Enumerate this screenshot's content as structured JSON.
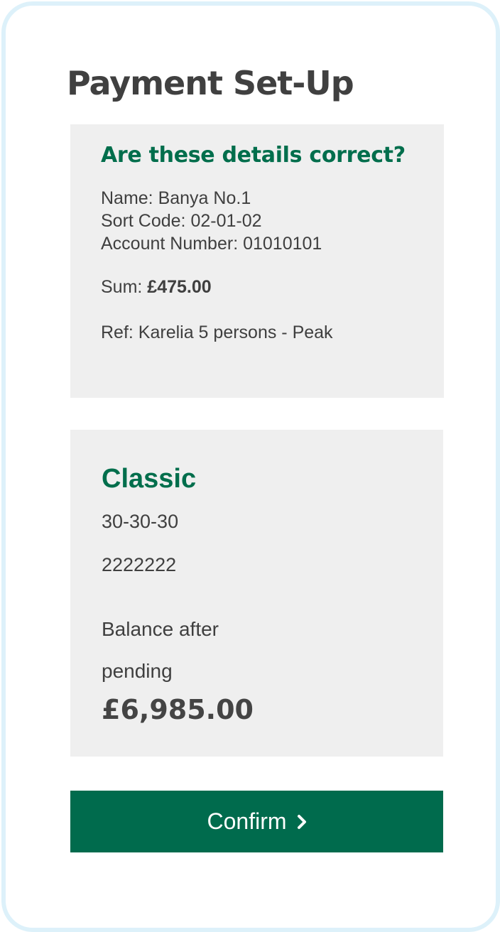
{
  "page": {
    "title": "Payment Set-Up"
  },
  "details": {
    "heading": "Are these details correct?",
    "name_line": "Name: Banya No.1",
    "sort_code_line": "Sort Code: 02-01-02",
    "account_number_line": "Account Number: 01010101",
    "sum_label": "Sum: ",
    "sum_value": "£475.00",
    "ref_line": "Ref: Karelia 5 persons - Peak"
  },
  "account": {
    "name": "Classic",
    "sort_code": "30-30-30",
    "account_number": "2222222",
    "balance_label": "Balance after pending",
    "balance_value": "£6,985.00"
  },
  "actions": {
    "confirm_label": "Confirm",
    "confirm_icon": "chevron-right-icon"
  },
  "colors": {
    "accent": "#006b4d",
    "card_background": "#efefef",
    "frame_border": "#ddf1fa"
  }
}
